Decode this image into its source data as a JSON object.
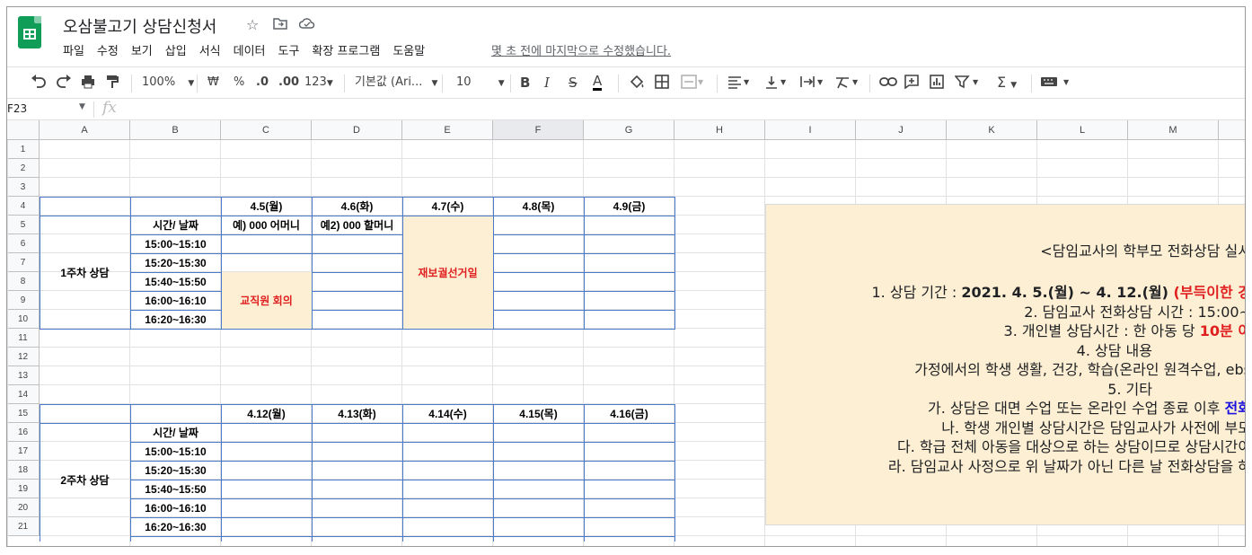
{
  "doc": {
    "title": "오삼불고기 상담신청서",
    "menu": [
      "파일",
      "수정",
      "보기",
      "삽입",
      "서식",
      "데이터",
      "도구",
      "확장 프로그램",
      "도움말"
    ],
    "last_edit": "몇 초 전에 마지막으로 수정했습니다."
  },
  "toolbar": {
    "zoom": "100%",
    "currency": "₩",
    "percent": "%",
    "dec_less": ".0",
    "dec_more": ".00",
    "format_more": "123",
    "font": "기본값 (Ari...",
    "font_size": "10"
  },
  "formula_bar": {
    "name_box": "F23",
    "fx": "fx"
  },
  "columns": [
    "A",
    "B",
    "C",
    "D",
    "E",
    "F",
    "G",
    "H",
    "I",
    "J",
    "K",
    "L",
    "M"
  ],
  "rows": [
    "1",
    "2",
    "3",
    "4",
    "5",
    "6",
    "7",
    "8",
    "9",
    "10",
    "11",
    "12",
    "13",
    "14",
    "15",
    "16",
    "17",
    "18",
    "19",
    "20",
    "21"
  ],
  "week1": {
    "label": "1주차 상담",
    "dates": [
      "4.5(월)",
      "4.6(화)",
      "4.7(수)",
      "4.8(목)",
      "4.9(금)"
    ],
    "header": "시간/ 날짜",
    "example1": "예) 000 어머니",
    "example2": "예2) 000 할머니",
    "times": [
      "15:00~15:10",
      "15:20~15:30",
      "15:40~15:50",
      "16:00~16:10",
      "16:20~16:30"
    ],
    "meeting": "교직원 회의",
    "election": "재보궐선거일"
  },
  "week2": {
    "label": "2주차 상담",
    "dates": [
      "4.12(월)",
      "4.13(화)",
      "4.14(수)",
      "4.15(목)",
      "4.16(금)"
    ],
    "header": "시간/ 날짜",
    "times": [
      "15:00~15:10",
      "15:20~15:30",
      "15:40~15:50",
      "16:00~16:10",
      "16:20~16:30"
    ]
  },
  "notice": {
    "title": "<담임교사의 학부모 전화상담 실시",
    "l1_a": "1. 상담 기간 : ",
    "l1_b": "2021. 4. 5.(월) ~ 4. 12.(월)",
    "l1_c": " (부득이한 경",
    "l2": "2. 담임교사 전화상담 시간 : 15:00~",
    "l3_a": "3. 개인별 상담시간 : 한 아동 당 ",
    "l3_b": "10분 이",
    "l4": "4. 상담 내용",
    "l5": "가정에서의 학생 생활, 건강, 학습(온라인 원격수업, ebs ",
    "l6": "5. 기타",
    "l7_a": "가. 상담은 대면 수업 또는 온라인 수업 종료 이후 ",
    "l7_b": "전화",
    "l8": "나. 학생 개인별 상담시간은 담임교사가 사전에 부모",
    "l9": "다. 학급 전체 아동을 대상으로 하는 상담이므로 상담시간이 ",
    "l10": "라. 담임교사 사정으로 위 날짜가 아닌 다른 날 전화상담을 하"
  },
  "colors": {
    "accent": "#0f9d58",
    "border": "#4a7ac8",
    "highlight": "#fcefd3",
    "red": "#e02020",
    "blue": "#1a10e0"
  }
}
